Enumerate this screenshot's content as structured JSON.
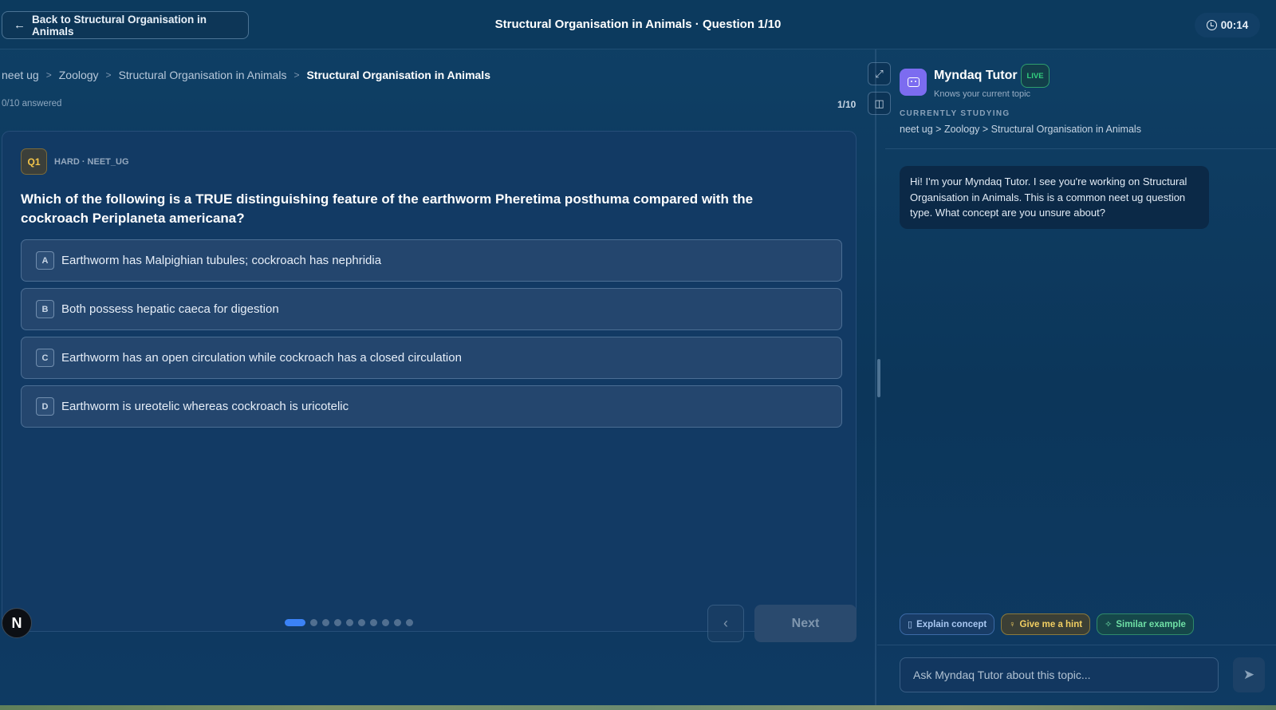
{
  "header": {
    "back_label": "Back to Structural Organisation in Animals",
    "title": "Structural Organisation in Animals · Question 1/10",
    "timer": "00:14"
  },
  "breadcrumb": {
    "items": [
      "neet ug",
      "Zoology",
      "Structural Organisation in Animals",
      "Structural Organisation in Animals"
    ],
    "separator": ">"
  },
  "progress": {
    "answered": "0/10 answered",
    "counter": "1/10"
  },
  "question": {
    "badge": "Q1",
    "meta": "HARD · NEET_UG",
    "text": "Which of the following is a TRUE distinguishing feature of the earthworm Pheretima posthuma compared with the cockroach Periplaneta americana?",
    "options": [
      {
        "letter": "A",
        "text": "Earthworm has Malpighian tubules; cockroach has nephridia"
      },
      {
        "letter": "B",
        "text": "Both possess hepatic caeca for digestion"
      },
      {
        "letter": "C",
        "text": "Earthworm has an open circulation while cockroach has a closed circulation"
      },
      {
        "letter": "D",
        "text": "Earthworm is ureotelic whereas cockroach is uricotelic"
      }
    ]
  },
  "footer": {
    "logo": "N",
    "dot_count": 10,
    "current_question": 1,
    "next_label": "Next"
  },
  "tutor": {
    "name": "Myndaq Tutor",
    "live_label": "LIVE",
    "subtitle": "Knows your current topic",
    "studying_label": "CURRENTLY STUDYING",
    "studying_path": "neet ug > Zoology > Structural Organisation in Animals",
    "message": "Hi! I'm your Myndaq Tutor. I see you're working on Structural Organisation in Animals. This is a common neet ug question type. What concept are you unsure about?",
    "chips": {
      "explain": "Explain concept",
      "hint": "Give me a hint",
      "similar": "Similar example"
    },
    "input_placeholder": "Ask Myndaq Tutor about this topic..."
  },
  "colors": {
    "accent": "#3b82f6",
    "hint": "#f2cf62",
    "similar": "#6fe0a6",
    "live": "#33d07f",
    "avatar": "#7c6cf0"
  }
}
